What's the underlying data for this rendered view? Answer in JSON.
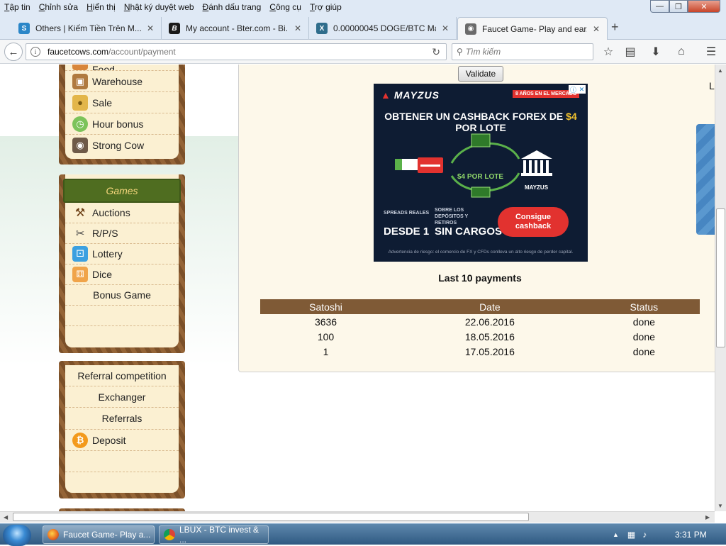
{
  "menu": [
    "Tập tin",
    "Chỉnh sửa",
    "Hiển thị",
    "Nhật ký duyệt web",
    "Đánh dấu trang",
    "Công cụ",
    "Trợ giúp"
  ],
  "tabs": [
    {
      "label": "Others | Kiếm Tiền Trên M...",
      "icon": "s-logo-icon",
      "color": "#2a86c8"
    },
    {
      "label": "My account - Bter.com - Bi...",
      "icon": "b-logo-icon",
      "color": "#1a1a1a"
    },
    {
      "label": "0.00000045 DOGE/BTC Mar...",
      "icon": "x-logo-icon",
      "color": "#2f6d8c"
    },
    {
      "label": "Faucet Game- Play and ear...",
      "icon": "cow-icon",
      "color": "#6b6b6b",
      "active": true
    }
  ],
  "address_bar": {
    "domain": "faucetcows.com",
    "path": "/account/payment"
  },
  "search": {
    "placeholder": "Tìm kiếm"
  },
  "sidebar": {
    "box1": [
      {
        "label": "Food",
        "icon": "food-icon"
      },
      {
        "label": "Warehouse",
        "icon": "warehouse-icon"
      },
      {
        "label": "Sale",
        "icon": "coins-icon"
      },
      {
        "label": "Hour bonus",
        "icon": "clock-icon"
      },
      {
        "label": "Strong Cow",
        "icon": "cow-icon"
      }
    ],
    "games_header": "Games",
    "games": [
      {
        "label": "Auctions",
        "icon": "gavel-icon"
      },
      {
        "label": "R/P/S",
        "icon": "rps-icon"
      },
      {
        "label": "Lottery",
        "icon": "lottery-icon"
      },
      {
        "label": "Dice",
        "icon": "dice-icon"
      },
      {
        "label": "Bonus Game",
        "icon": ""
      }
    ],
    "box3": [
      {
        "label": "Referral competition"
      },
      {
        "label": "Exchanger"
      },
      {
        "label": "Referrals"
      },
      {
        "label": "Deposit",
        "icon": "bitcoin-icon"
      }
    ]
  },
  "main": {
    "validate_label": "Validate",
    "payments_title": "Last 10 payments",
    "table": {
      "headers": [
        "Satoshi",
        "Date",
        "Status"
      ],
      "rows": [
        [
          "3636",
          "22.06.2016",
          "done"
        ],
        [
          "100",
          "18.05.2016",
          "done"
        ],
        [
          "1",
          "17.05.2016",
          "done"
        ]
      ]
    },
    "right_letter": "L"
  },
  "ad": {
    "brand": "MAYZUS",
    "badge": "8 AÑOS EN EL MERCADO",
    "headline_pre": "OBTENER UN CASHBACK FOREX DE ",
    "headline_accent": "$4",
    "headline_post": " POR LOTE",
    "center_label": "$4 POR LOTE",
    "bank_label": "MAYZUS",
    "feature1_small": "SPREADS REALES",
    "feature1_big": "DESDE 1",
    "feature2_small": "SOBRE LOS DEPÓSITOS Y RETIROS",
    "feature2_big": "SIN CARGOS",
    "cta": "Consigue cashback",
    "disclaimer": "Advertencia de riesgo: el comercio de FX y CFDs conlleva un alto riesgo de perder capital."
  },
  "taskbar": {
    "buttons": [
      {
        "label": "Faucet Game- Play a...",
        "icon": "firefox-icon"
      },
      {
        "label": "LBUX - BTC invest & ...",
        "icon": "chrome-icon"
      }
    ],
    "clock": "3:31 PM"
  },
  "colors": {
    "table_header": "#7f5a36",
    "games_header": "#4f6d20",
    "panel_bg": "#fdf8ea"
  }
}
